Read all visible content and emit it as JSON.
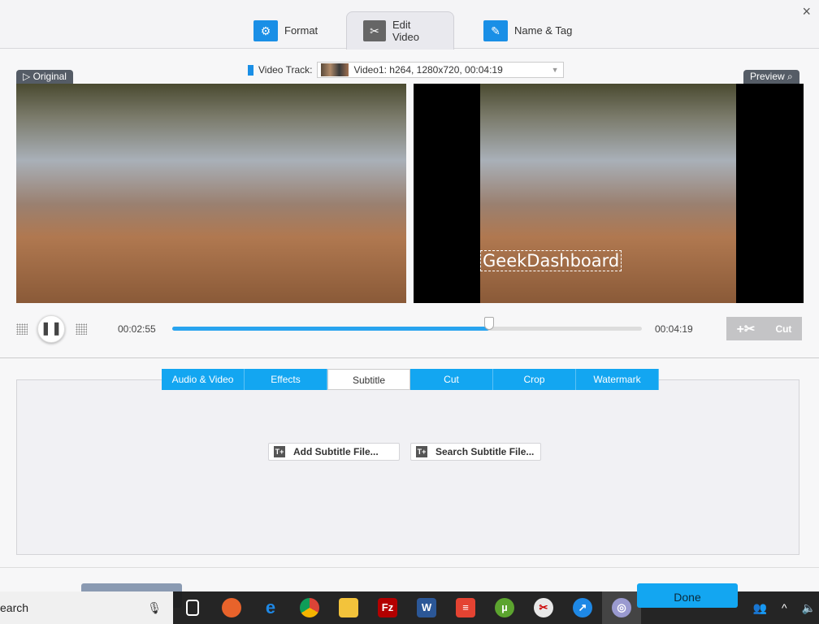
{
  "header": {
    "tabs": [
      {
        "label": "Format",
        "icon": "format-settings-icon"
      },
      {
        "label": "Edit Video",
        "icon": "edit-video-icon",
        "active": true
      },
      {
        "label": "Name & Tag",
        "icon": "name-tag-icon"
      }
    ],
    "close": "×"
  },
  "video_track": {
    "label": "Video Track:",
    "value": "Video1: h264, 1280x720, 00:04:19"
  },
  "original_label": "Original",
  "preview_label": "Preview",
  "watermark_text": "GeekDashboard",
  "playback": {
    "current": "00:02:55",
    "total": "00:04:19",
    "progress": 0.675,
    "cut_label": "Cut"
  },
  "sub_tabs": [
    {
      "label": "Audio & Video"
    },
    {
      "label": "Effects"
    },
    {
      "label": "Subtitle",
      "active": true
    },
    {
      "label": "Cut"
    },
    {
      "label": "Crop"
    },
    {
      "label": "Watermark"
    }
  ],
  "subtitle": {
    "add": "Add Subtitle File...",
    "search": "Search Subtitle File..."
  },
  "footer": {
    "done": "Done"
  },
  "taskbar": {
    "search": "earch",
    "apps": [
      "task-view",
      "firefox",
      "edge",
      "chrome",
      "file-explorer",
      "filezilla",
      "word",
      "todoist",
      "utorrent",
      "snipping",
      "app-blue",
      "video-converter"
    ]
  },
  "colors": {
    "accent": "#13a6f1",
    "progress": "#29a4ef"
  }
}
